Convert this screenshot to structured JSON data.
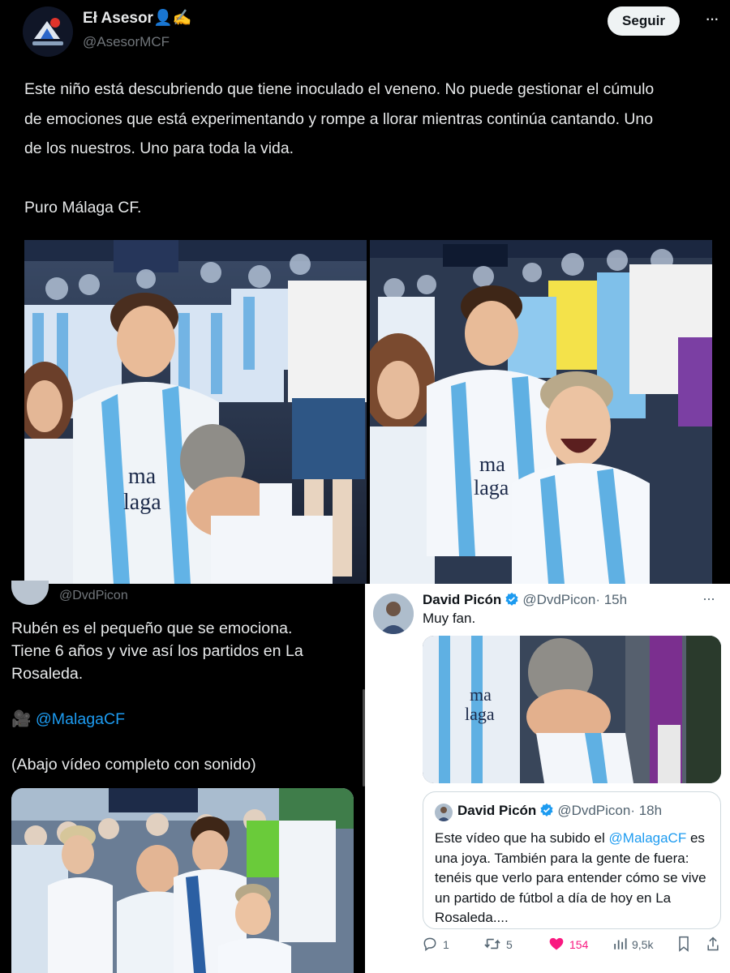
{
  "top_tweet": {
    "author_name": "Eł Asesor👤✍️",
    "handle": "@AsesorMCF",
    "follow_label": "Seguir",
    "more_label": "···",
    "text_line1": "Este niño está descubriendo que tiene inoculado el veneno. No puede gestionar el cúmulo",
    "text_line2": "de emociones que está experimentando y rompe a llorar mientras continúa cantando. Uno",
    "text_line3": "de los nuestros. Uno para toda la vida.",
    "text_line4": "Puro Málaga CF.",
    "photo_left_alt": "niño llorando en la grada",
    "photo_right_alt": "aficionados del Málaga en la grada",
    "shirt_text_1": "ma",
    "shirt_text_2": "laga"
  },
  "bottom_left_tweet": {
    "handle": "@DvdPicon",
    "text_line1": "Rubén es el pequeño que se emociona.",
    "text_line2": "Tiene 6 años y vive así los partidos en La",
    "text_line3": "Rosaleda.",
    "camera_emoji": "🎥",
    "mention": "@MalagaCF",
    "text_line4": "(Abajo vídeo completo con sonido)"
  },
  "bottom_right_tweet": {
    "author_name": "David Picón",
    "handle": "@DvdPicon",
    "time": "· 15h",
    "more_label": "···",
    "text": "Muy fan.",
    "quote": {
      "author_name": "David Picón",
      "handle": "@DvdPicon",
      "time": "· 18h",
      "text_before_mention": "Este vídeo que ha subido el ",
      "mention": "@MalagaCF",
      "text_after_mention": " es",
      "line2": "una joya. También para la gente de fuera:",
      "line3": "tenéis que verlo para entender cómo se vive",
      "line4": "un partido de fútbol a día de hoy en La",
      "line5": "Rosaleda...."
    },
    "actions": {
      "replies": "1",
      "reposts": "5",
      "likes": "154",
      "views": "9,5k"
    },
    "colors": {
      "like": "#f91880",
      "verified": "#1d9bf0",
      "link": "#1d9bf0"
    }
  }
}
